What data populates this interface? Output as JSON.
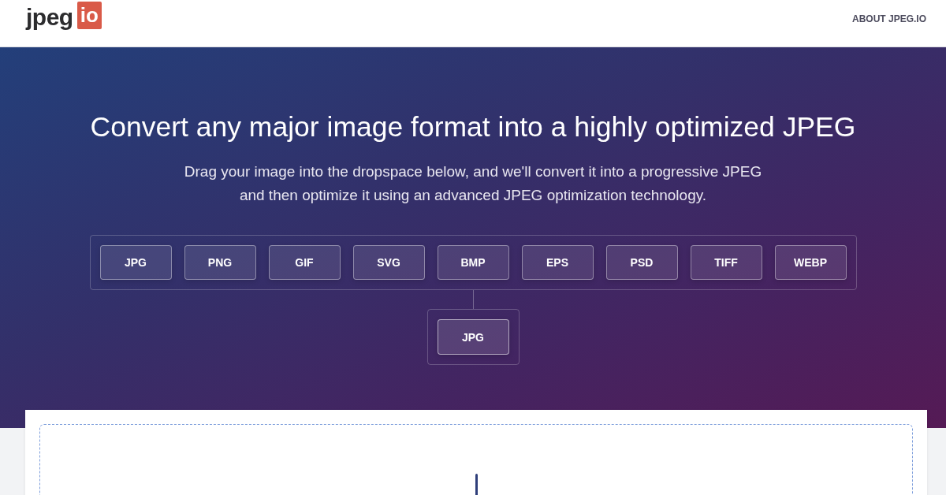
{
  "header": {
    "logo": {
      "wordmark": "jpeg",
      "badge": "io"
    },
    "nav": [
      {
        "label": "ABOUT JPEG.IO"
      }
    ]
  },
  "hero": {
    "title": "Convert any major image format into a highly optimized JPEG",
    "subtitle": [
      "Drag your image into the dropspace below, and we'll convert it into a progressive JPEG",
      "and then optimize it using an advanced JPEG optimization technology."
    ],
    "input_formats": [
      "JPG",
      "PNG",
      "GIF",
      "SVG",
      "BMP",
      "EPS",
      "PSD",
      "TIFF",
      "WEBP"
    ],
    "output_format": "JPG"
  }
}
